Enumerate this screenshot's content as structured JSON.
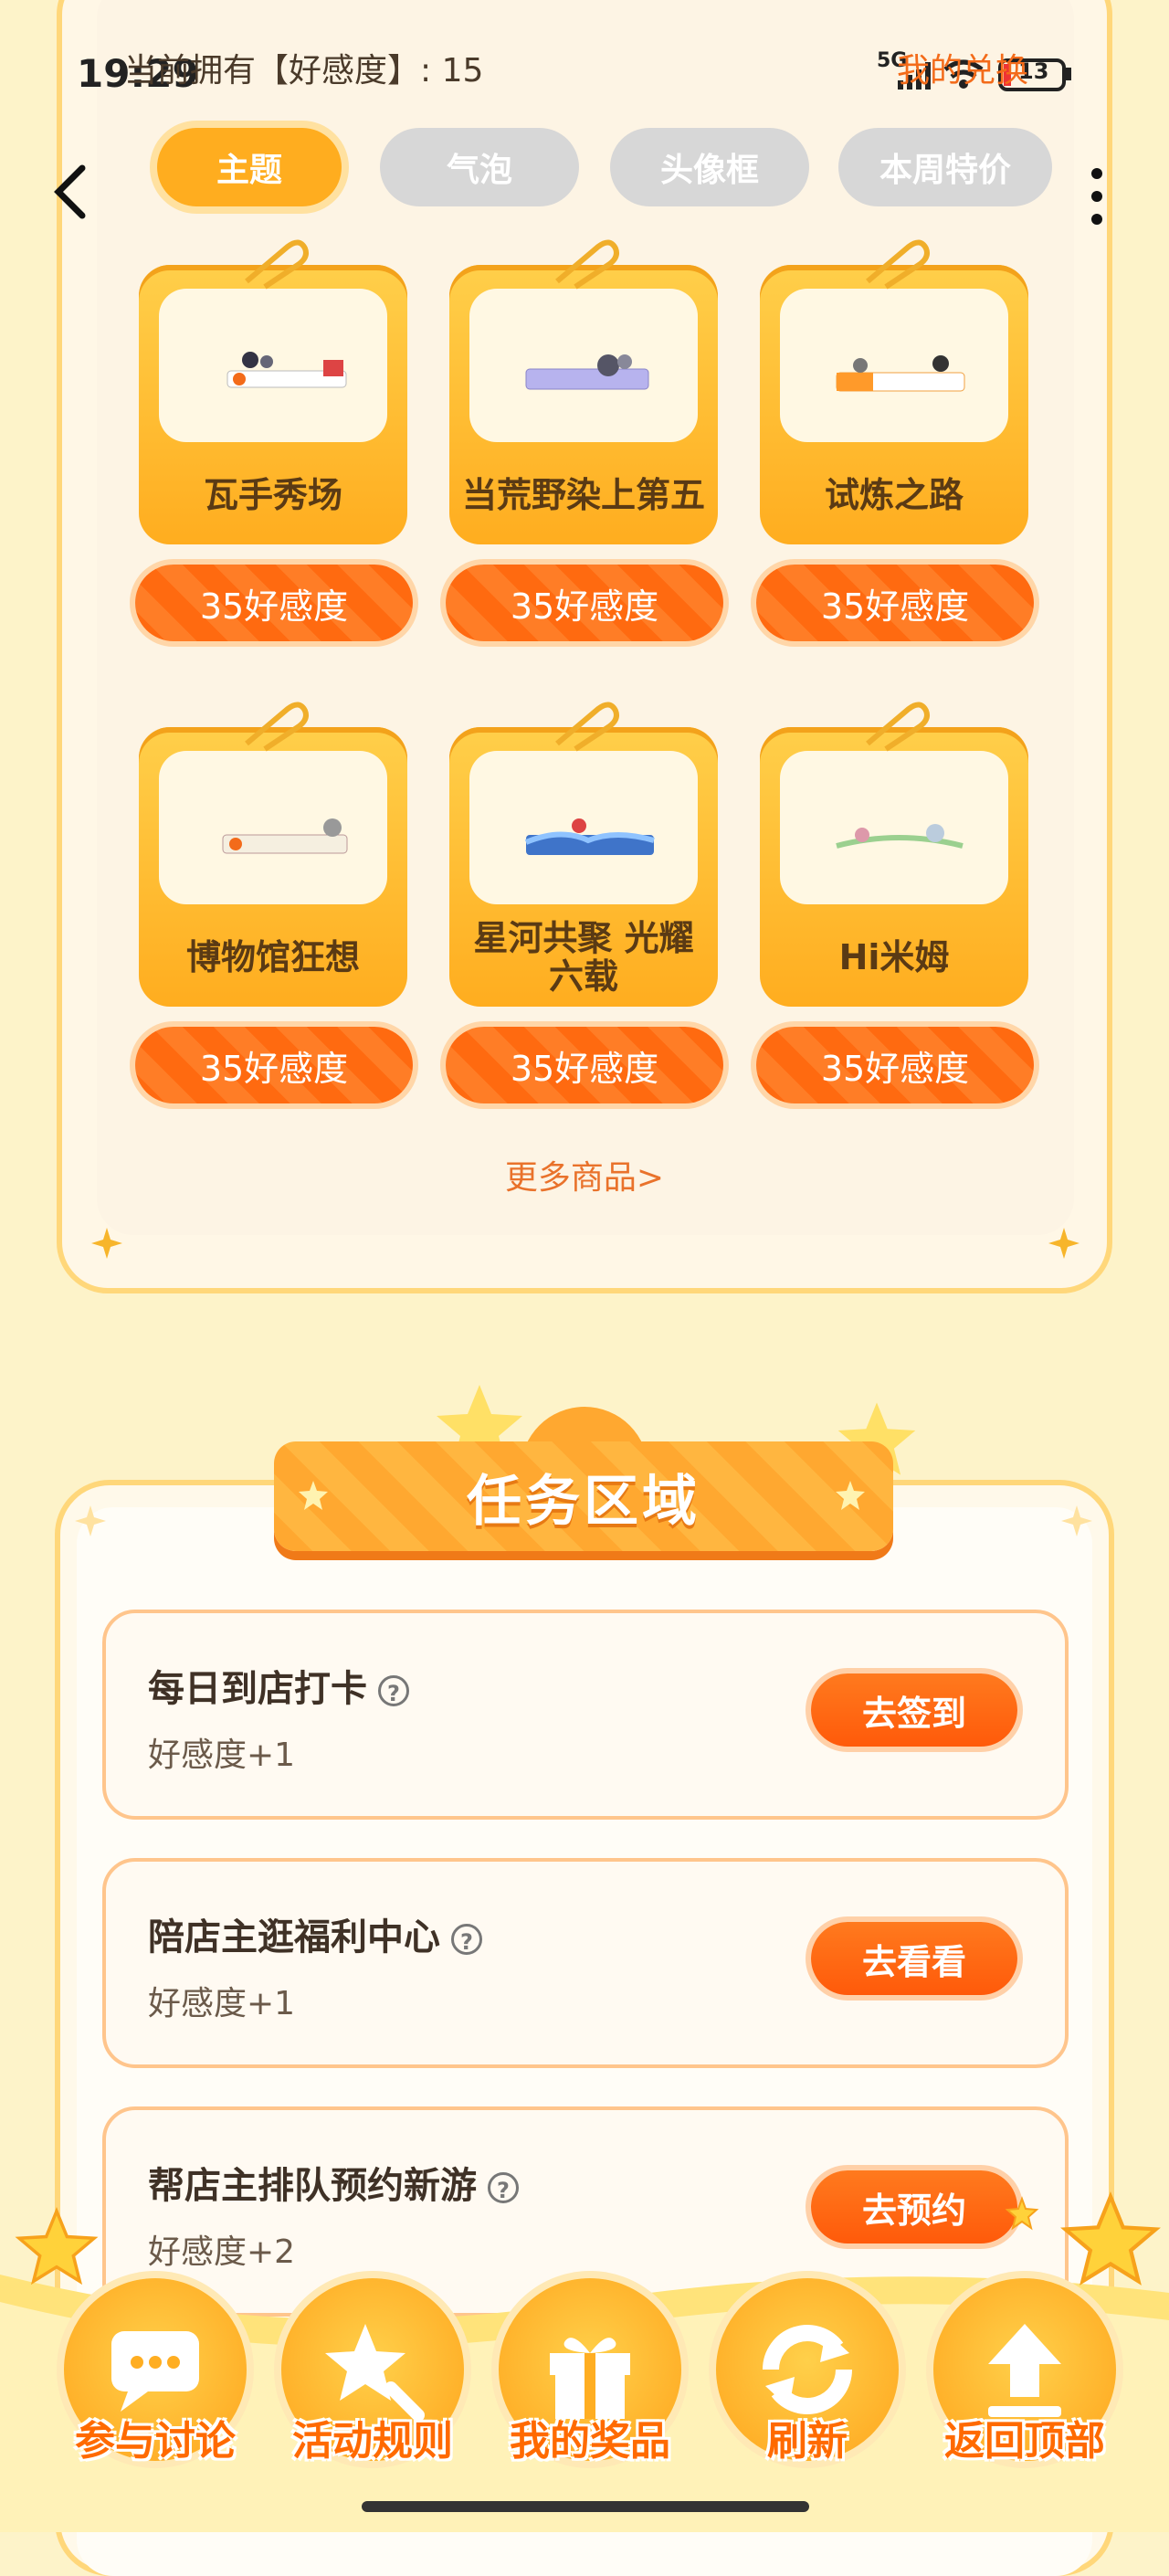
{
  "status_bar": {
    "time": "19:29",
    "network": "5G",
    "battery": "13"
  },
  "header": {
    "currency_text": "当前拥有【好感度】: 15",
    "my_exchange": "我的兑换"
  },
  "tabs": [
    {
      "label": "主题",
      "active": true
    },
    {
      "label": "气泡",
      "active": false
    },
    {
      "label": "头像框",
      "active": false
    },
    {
      "label": "本周特价",
      "active": false
    }
  ],
  "products": [
    {
      "name": "瓦手秀场",
      "price": "35好感度"
    },
    {
      "name": "当荒野染上第五",
      "price": "35好感度"
    },
    {
      "name": "试炼之路",
      "price": "35好感度"
    },
    {
      "name": "博物馆狂想",
      "price": "35好感度"
    },
    {
      "name": "星河共聚 光耀六载",
      "price": "35好感度"
    },
    {
      "name": "Hi米姆",
      "price": "35好感度"
    }
  ],
  "more_goods": "更多商品>",
  "task_section": {
    "title": "任务区域",
    "tasks": [
      {
        "name": "每日到店打卡",
        "reward": "好感度+1",
        "button": "去签到"
      },
      {
        "name": "陪店主逛福利中心",
        "reward": "好感度+1",
        "button": "去看看"
      },
      {
        "name": "帮店主排队预约新游",
        "reward": "好感度+2",
        "button": "去预约"
      }
    ]
  },
  "bottom_nav": [
    {
      "label": "参与讨论",
      "icon": "chat-icon"
    },
    {
      "label": "活动规则",
      "icon": "magnifier-star-icon"
    },
    {
      "label": "我的奖品",
      "icon": "gift-icon"
    },
    {
      "label": "刷新",
      "icon": "refresh-icon"
    },
    {
      "label": "返回顶部",
      "icon": "upload-arrow-icon"
    }
  ],
  "colors": {
    "accent": "#ffad1f",
    "orange": "#ff6a10",
    "background": "#fdf3c9"
  }
}
